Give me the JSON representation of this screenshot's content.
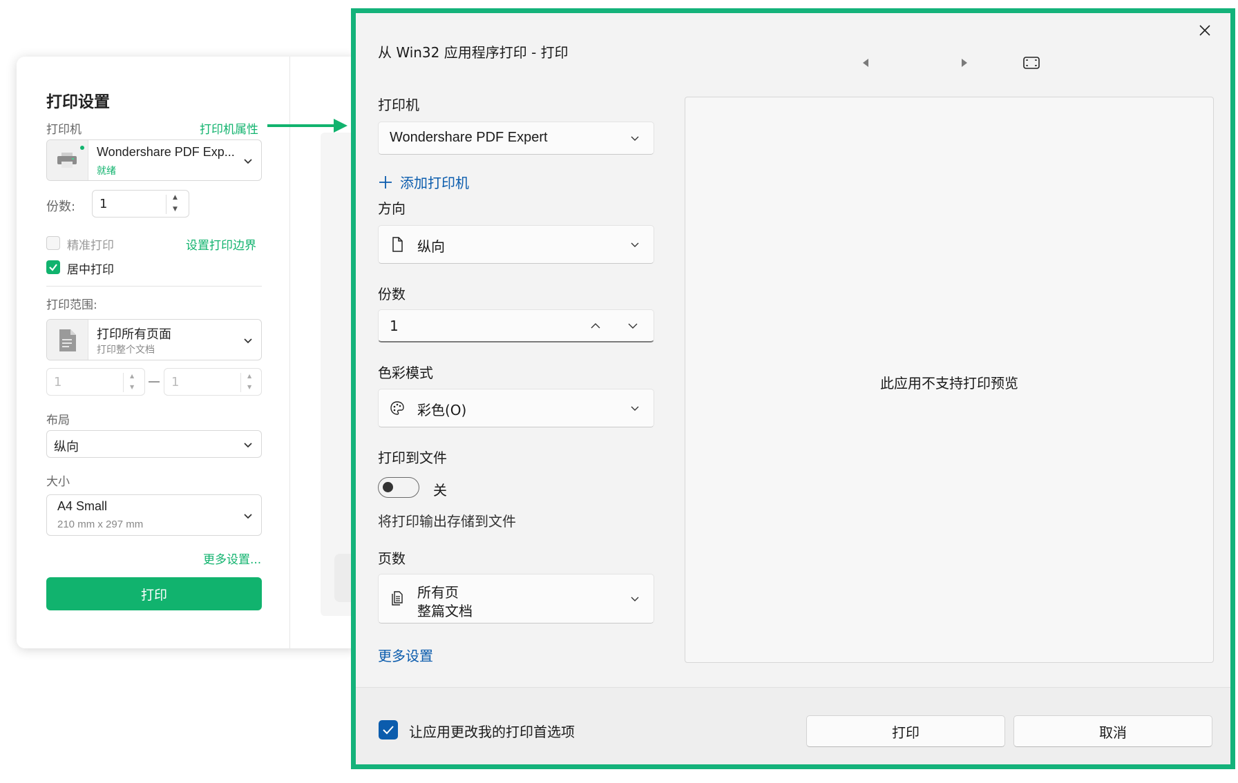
{
  "left_panel": {
    "title": "打印设置",
    "printer_label": "打印机",
    "printer_props_link": "打印机属性",
    "printer_name": "Wondershare PDF Exp...",
    "printer_status": "就绪",
    "copies_label": "份数:",
    "copies_value": "1",
    "precise_print_label": "精准打印",
    "precise_print_checked": false,
    "set_margin_link": "设置打印边界",
    "center_print_label": "居中打印",
    "center_print_checked": true,
    "range_label": "打印范围:",
    "range_main": "打印所有页面",
    "range_sub": "打印整个文档",
    "range_from": "1",
    "range_to": "1",
    "layout_label": "布局",
    "layout_value": "纵向",
    "size_label": "大小",
    "size_main": "A4 Small",
    "size_sub": "210 mm x 297 mm",
    "more_settings_link": "更多设置...",
    "print_button": "打印",
    "accent_color": "#11b36e"
  },
  "dialog": {
    "title": "从 Win32 应用程序打印 - 打印",
    "printer_label": "打印机",
    "printer_value": "Wondershare PDF Expert",
    "add_printer": "添加打印机",
    "orientation_label": "方向",
    "orientation_value": "纵向",
    "copies_label": "份数",
    "copies_value": "1",
    "color_mode_label": "色彩模式",
    "color_mode_value": "彩色(O)",
    "print_to_file_label": "打印到文件",
    "print_to_file_state": "关",
    "print_to_file_on": false,
    "print_to_file_desc": "将打印输出存储到文件",
    "pages_label": "页数",
    "pages_main": "所有页",
    "pages_sub": "整篇文档",
    "more_settings": "更多设置",
    "preview_message": "此应用不支持打印预览",
    "allow_app_change_label": "让应用更改我的打印首选项",
    "allow_app_change_checked": true,
    "print_button": "打印",
    "cancel_button": "取消",
    "border_color": "#14b27a",
    "link_color": "#0b5cad"
  }
}
